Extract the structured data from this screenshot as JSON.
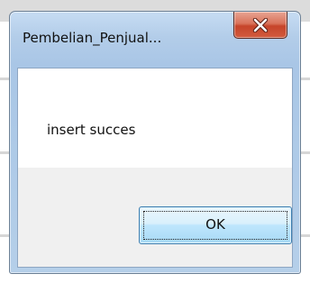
{
  "window": {
    "title": "Pembelian_Penjual...",
    "close_icon": "close-icon"
  },
  "message": {
    "text": "insert succes"
  },
  "buttons": {
    "ok_label": "OK"
  },
  "colors": {
    "frame": "#b3cde9",
    "close_button": "#c6442a",
    "ok_button": "#bee6fd",
    "client_bg": "#f0f0f0",
    "message_bg": "#ffffff"
  }
}
